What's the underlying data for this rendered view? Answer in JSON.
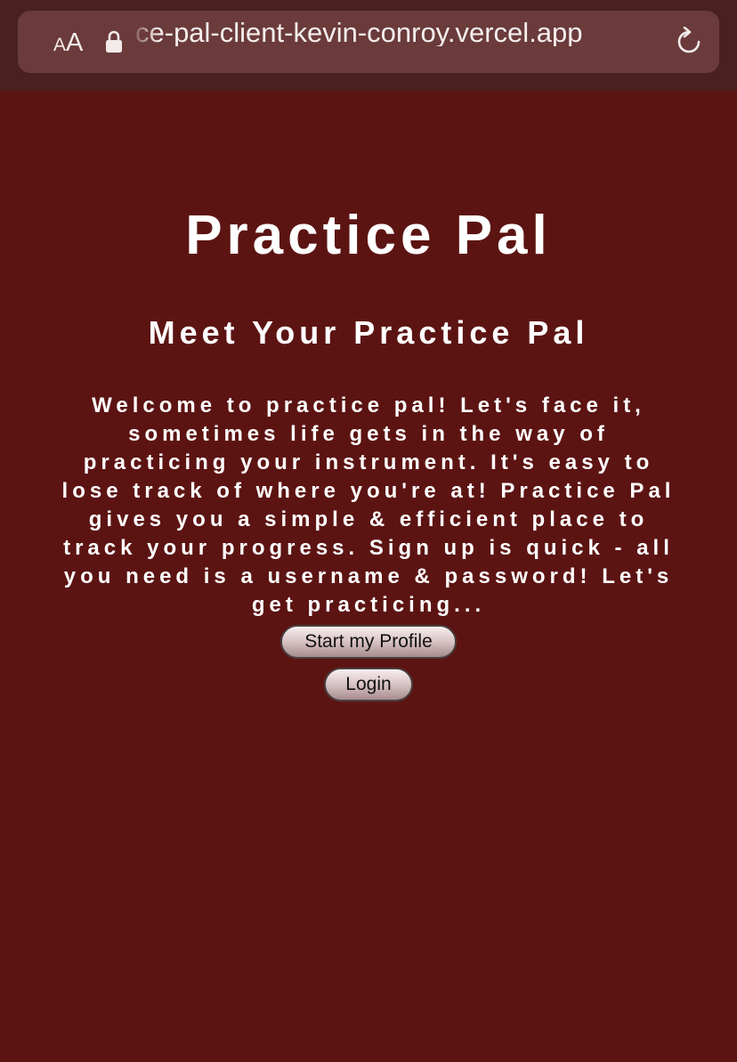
{
  "browser": {
    "text_size_label_small": "A",
    "text_size_label_big": "A",
    "url": "ce-pal-client-kevin-conroy.vercel.app",
    "icons": [
      "lock-icon",
      "reload-icon"
    ]
  },
  "page": {
    "title": "Practice Pal",
    "subtitle": "Meet Your Practice Pal",
    "welcome": "Welcome to practice pal! Let's face it, sometimes life gets in the way of practicing your instrument. It's easy to lose track of where you're at! Practice Pal gives you a simple & efficient place to track your progress. Sign up is quick - all you need is a username & password! Let's get practicing...",
    "start_button_label": "Start my Profile",
    "login_button_label": "Login"
  },
  "colors": {
    "page_background": "#5c1413",
    "toolbar_background": "#4a2020",
    "urlbar_background": "#6b3b3b",
    "text": "#ffffff"
  }
}
